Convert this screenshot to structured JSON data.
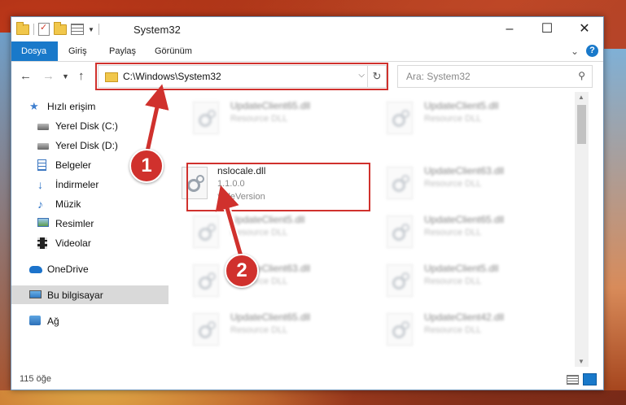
{
  "window": {
    "title": "System32"
  },
  "ribbon": {
    "tabs": [
      "Dosya",
      "Giriş",
      "Paylaş",
      "Görünüm"
    ]
  },
  "address": {
    "path": "C:\\Windows\\System32"
  },
  "search": {
    "placeholder": "Ara: System32"
  },
  "sidebar": {
    "items": [
      {
        "label": "Hızlı erişim",
        "icon": "star-icon"
      },
      {
        "label": "Yerel Disk (C:)",
        "icon": "drive-icon",
        "pinned": true
      },
      {
        "label": "Yerel Disk (D:)",
        "icon": "drive-icon",
        "pinned": true
      },
      {
        "label": "Belgeler",
        "icon": "documents-icon",
        "pinned": true
      },
      {
        "label": "İndirmeler",
        "icon": "download-icon",
        "pinned": true
      },
      {
        "label": "Müzik",
        "icon": "music-icon",
        "pinned": true
      },
      {
        "label": "Resimler",
        "icon": "pictures-icon",
        "pinned": true
      },
      {
        "label": "Videolar",
        "icon": "videos-icon",
        "pinned": true
      },
      {
        "label": "OneDrive",
        "icon": "cloud-icon"
      },
      {
        "label": "Bu bilgisayar",
        "icon": "computer-icon",
        "selected": true
      },
      {
        "label": "Ağ",
        "icon": "network-icon"
      }
    ]
  },
  "files": [
    {
      "name": "UpdateClient65.dll",
      "type": "Resource DLL",
      "desc": ""
    },
    {
      "name": "UpdateClient5.dll",
      "type": "Resource DLL",
      "desc": ""
    },
    {
      "name": "nslocale.dll",
      "type": "1.1.0.0",
      "desc": "*FileVersion"
    },
    {
      "name": "UpdateClient63.dll",
      "type": "Resource DLL",
      "desc": ""
    },
    {
      "name": "UpdateClient5.dll",
      "type": "Resource DLL",
      "desc": ""
    },
    {
      "name": "UpdateClient65.dll",
      "type": "Resource DLL",
      "desc": ""
    },
    {
      "name": "UpdateClient63.dll",
      "type": "Resource DLL",
      "desc": ""
    },
    {
      "name": "UpdateClient5.dll",
      "type": "Resource DLL",
      "desc": ""
    },
    {
      "name": "UpdateClient65.dll",
      "type": "Resource DLL",
      "desc": ""
    },
    {
      "name": "UpdateClient42.dll",
      "type": "Resource DLL",
      "desc": ""
    }
  ],
  "status": {
    "count": "115 öğe"
  },
  "annotations": {
    "step1": "1",
    "step2": "2",
    "color": "#d0312d"
  }
}
